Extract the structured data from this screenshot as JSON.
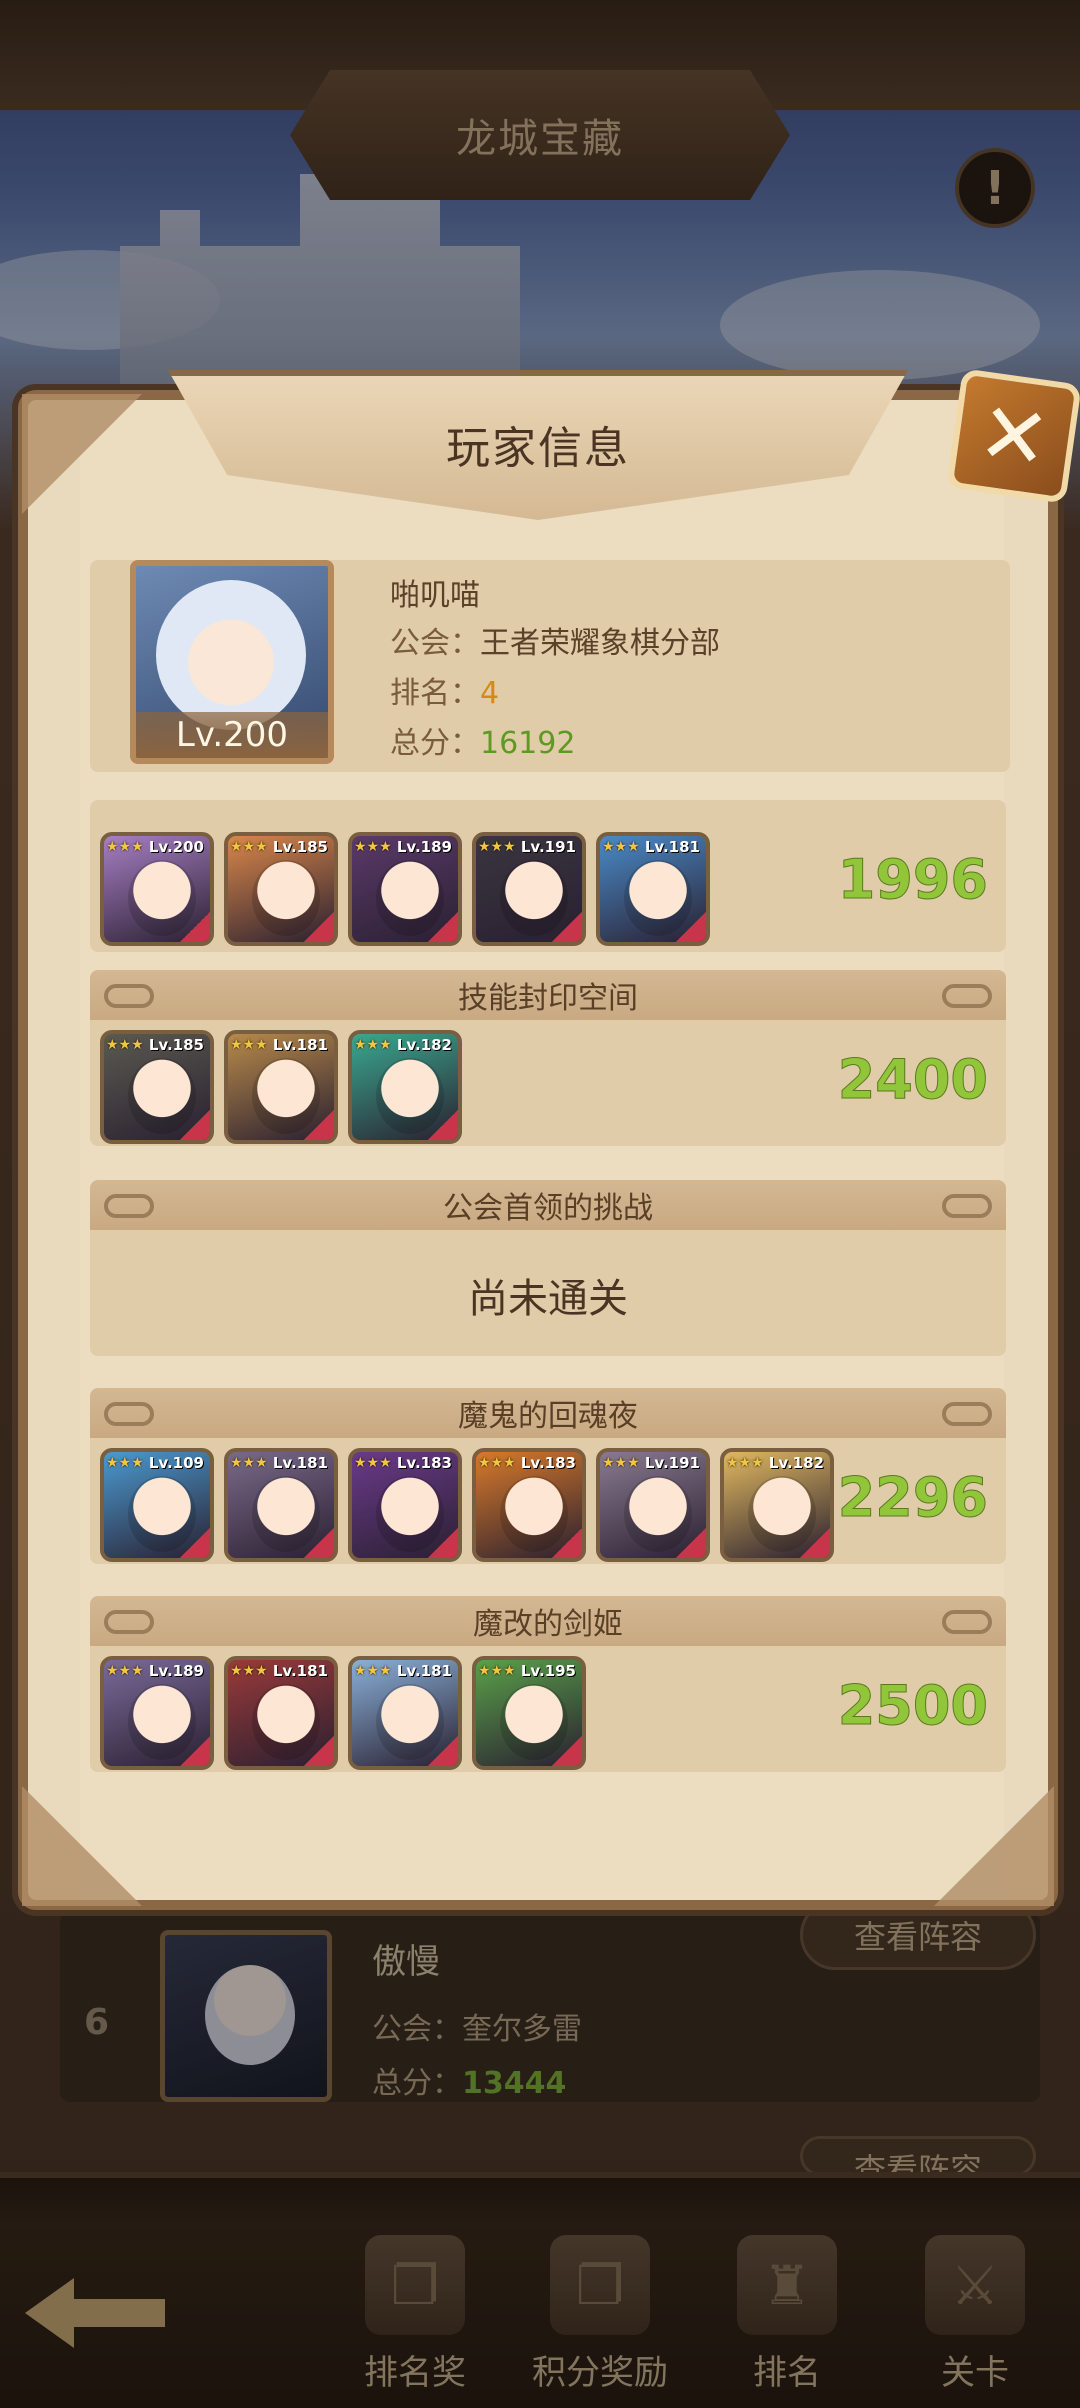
{
  "screen": {
    "title": "龙城宝藏",
    "info_icon": "exclamation-icon"
  },
  "modal": {
    "title": "玩家信息",
    "close_icon": "close-icon",
    "player": {
      "name": "啪叽喵",
      "level": "Lv.200",
      "guild_label": "公会：",
      "guild": "王者荣耀象棋分部",
      "rank_label": "排名：",
      "rank": "4",
      "score_label": "总分：",
      "score": "16192"
    },
    "sections": [
      {
        "title": "",
        "score": "1996",
        "heroes": [
          {
            "level": "Lv.200",
            "color": "#a77fc4"
          },
          {
            "level": "Lv.185",
            "color": "#d9874a"
          },
          {
            "level": "Lv.189",
            "color": "#5a3a6a"
          },
          {
            "level": "Lv.191",
            "color": "#3a3540"
          },
          {
            "level": "Lv.181",
            "color": "#4a8ac8"
          }
        ]
      },
      {
        "title": "技能封印空间",
        "score": "2400",
        "heroes": [
          {
            "level": "Lv.185",
            "color": "#5a5a50"
          },
          {
            "level": "Lv.181",
            "color": "#b88a4a"
          },
          {
            "level": "Lv.182",
            "color": "#3aa890"
          }
        ]
      },
      {
        "title": "公会首领的挑战",
        "empty_text": "尚未通关"
      },
      {
        "title": "魔鬼的回魂夜",
        "score": "2296",
        "heroes": [
          {
            "level": "Lv.109",
            "color": "#4a9ad0"
          },
          {
            "level": "Lv.181",
            "color": "#7a6a8a"
          },
          {
            "level": "Lv.183",
            "color": "#6a3a8a"
          },
          {
            "level": "Lv.183",
            "color": "#d87a2a"
          },
          {
            "level": "Lv.191",
            "color": "#8a7a90"
          },
          {
            "level": "Lv.182",
            "color": "#e0b860"
          }
        ]
      },
      {
        "title": "魔改的剑姬",
        "score": "2500",
        "heroes": [
          {
            "level": "Lv.189",
            "color": "#7a6a9a"
          },
          {
            "level": "Lv.181",
            "color": "#9a3a3a"
          },
          {
            "level": "Lv.181",
            "color": "#8ab0d8"
          },
          {
            "level": "Lv.195",
            "color": "#5aa04a"
          }
        ]
      }
    ]
  },
  "rank_list": {
    "row": {
      "rank": "6",
      "name": "傲慢",
      "guild_label": "公会：",
      "guild": "奎尔多雷",
      "score_label": "总分：",
      "score": "13444"
    },
    "view_lineup": "查看阵容"
  },
  "bottom_nav": {
    "back_icon": "back-arrow-icon",
    "items": [
      {
        "label": "排名奖",
        "icon": "rank-reward-icon"
      },
      {
        "label": "积分奖励",
        "icon": "points-reward-icon"
      },
      {
        "label": "排名",
        "icon": "ranking-icon"
      },
      {
        "label": "关卡",
        "icon": "stage-icon"
      }
    ]
  },
  "colors": {
    "score_green": "#92c63a",
    "rank_orange": "#d48a18",
    "frame_brown": "#8a6845"
  }
}
